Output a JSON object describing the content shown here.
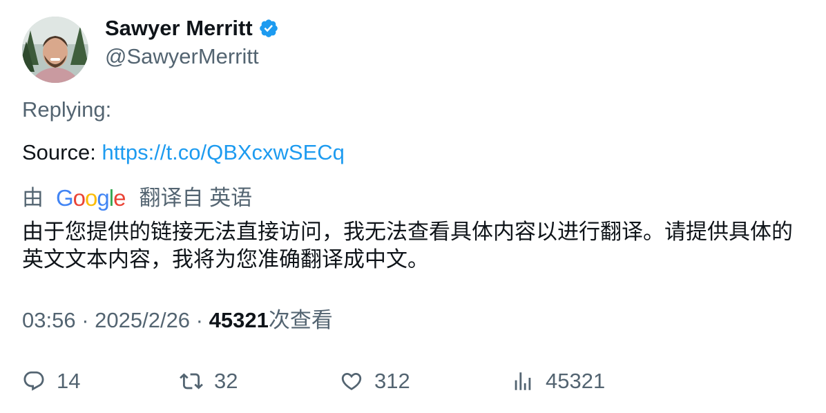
{
  "author": {
    "display_name": "Sawyer Merritt",
    "handle": "@SawyerMerritt",
    "verified": true,
    "verified_color": "#1d9bf0"
  },
  "replying_label": "Replying:",
  "body": {
    "source_label": "Source: ",
    "link_text": "https://t.co/QBXcxwSECq"
  },
  "translation": {
    "by_label": "由",
    "provider": "Google",
    "translated_from_label": "翻译自 英语",
    "text": "由于您提供的链接无法直接访问，我无法查看具体内容以进行翻译。请提供具体的英文文本内容，我将为您准确翻译成中文。"
  },
  "meta": {
    "time": "03:56",
    "separator": " · ",
    "date": "2025/2/26",
    "views_count": "45321",
    "views_label": "次查看"
  },
  "actions": {
    "reply_count": "14",
    "retweet_count": "32",
    "like_count": "312",
    "views_count": "45321"
  },
  "colors": {
    "link": "#1d9bf0",
    "secondary_text": "#536471",
    "primary_text": "#0f1419"
  },
  "icons": {
    "reply": "reply-icon",
    "retweet": "retweet-icon",
    "like": "heart-icon",
    "views": "bar-chart-icon",
    "verified": "verified-badge-icon"
  }
}
